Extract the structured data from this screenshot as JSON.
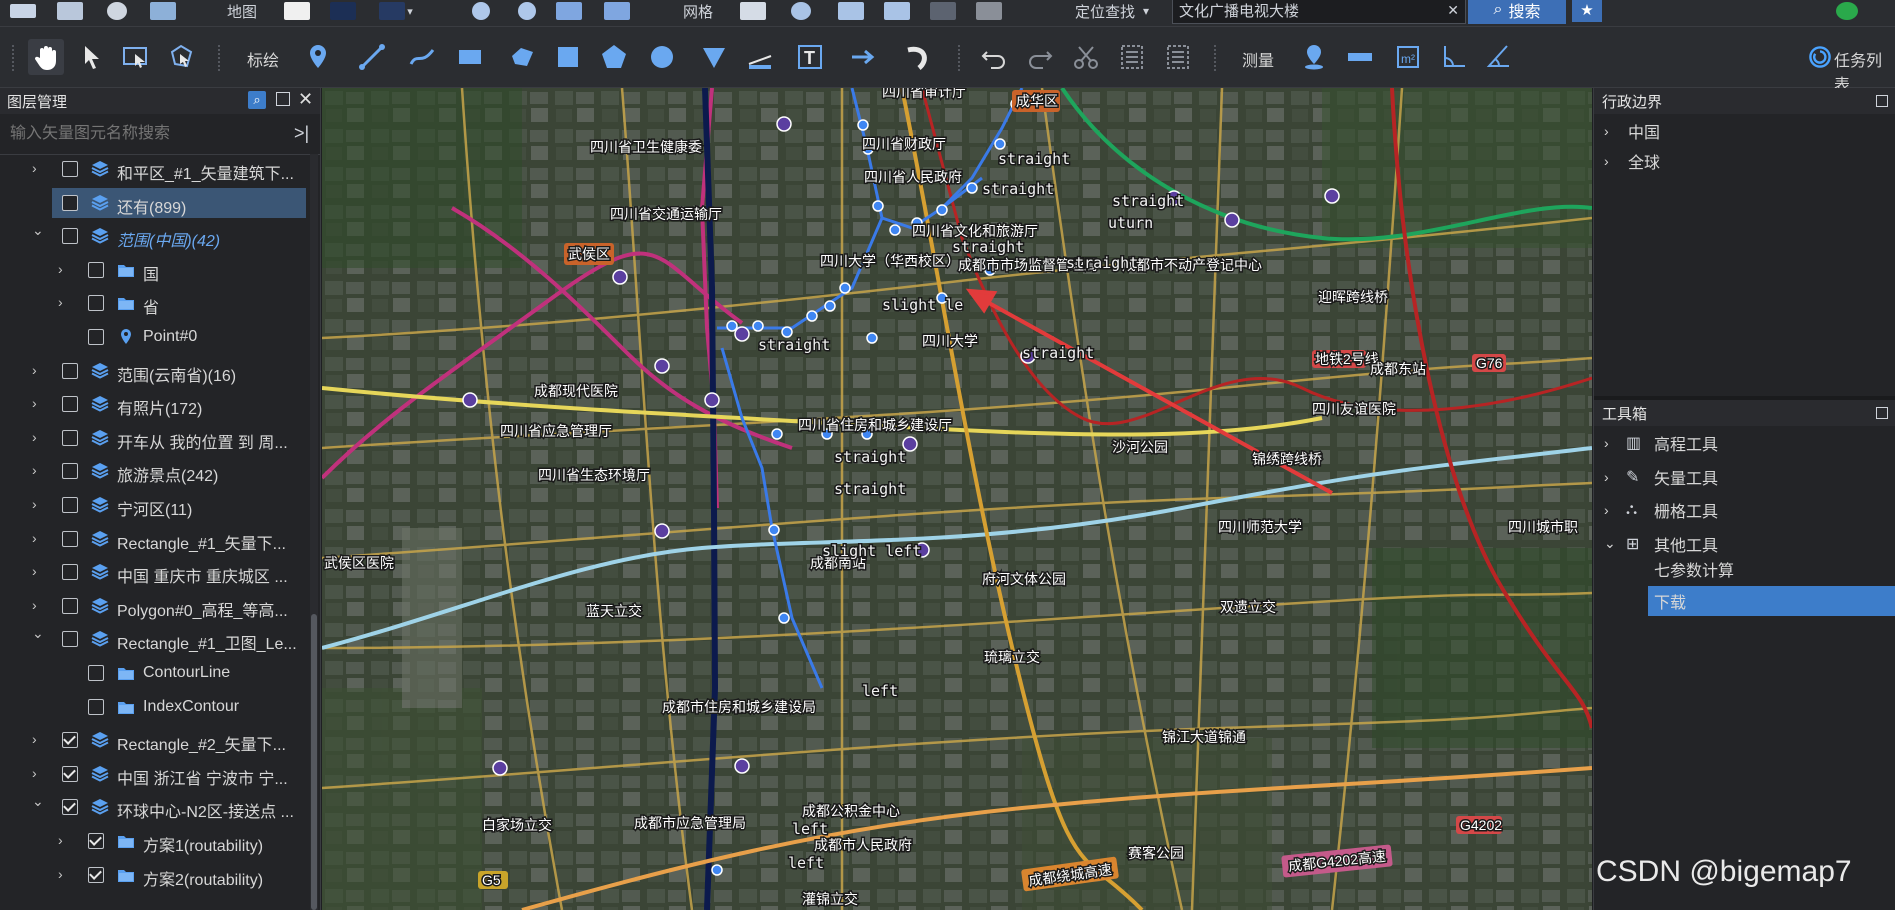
{
  "topbar": {
    "map_label": "地图",
    "grid_label": "网格",
    "locate_dropdown": "定位查找",
    "search_value": "文化广播电视大楼",
    "search_button": "搜索"
  },
  "toolbar": {
    "draw_label": "标绘",
    "measure_label": "测量",
    "task_list": "任务列表"
  },
  "layer_panel": {
    "title": "图层管理",
    "search_placeholder": "输入矢量图元名称搜索",
    "rows": [
      {
        "label": "和平区_#1_矢量建筑下...",
        "checked": false,
        "expander": "right",
        "icon": "layers-icon",
        "indent": 0
      },
      {
        "label": "还有(899)",
        "checked": false,
        "expander": "right",
        "icon": "layers-icon",
        "indent": 0,
        "selected": true
      },
      {
        "label": "范围(中国)(42)",
        "checked": false,
        "expander": "down",
        "icon": "layers-icon",
        "indent": 0,
        "italic": true
      },
      {
        "label": "国",
        "checked": false,
        "expander": "right",
        "icon": "folder-icon",
        "indent": 1
      },
      {
        "label": "省",
        "checked": false,
        "expander": "right",
        "icon": "folder-icon",
        "indent": 1
      },
      {
        "label": "Point#0",
        "checked": false,
        "expander": "none",
        "icon": "pin-icon",
        "indent": 1
      },
      {
        "label": "范围(云南省)(16)",
        "checked": false,
        "expander": "right",
        "icon": "layers-icon",
        "indent": 0
      },
      {
        "label": "有照片(172)",
        "checked": false,
        "expander": "right",
        "icon": "layers-icon",
        "indent": 0
      },
      {
        "label": "开车从 我的位置 到 周...",
        "checked": false,
        "expander": "right",
        "icon": "layers-icon",
        "indent": 0
      },
      {
        "label": "旅游景点(242)",
        "checked": false,
        "expander": "right",
        "icon": "layers-icon",
        "indent": 0
      },
      {
        "label": "宁河区(11)",
        "checked": false,
        "expander": "right",
        "icon": "layers-icon",
        "indent": 0
      },
      {
        "label": "Rectangle_#1_矢量下...",
        "checked": false,
        "expander": "right",
        "icon": "layers-icon",
        "indent": 0
      },
      {
        "label": "中国 重庆市 重庆城区 ...",
        "checked": false,
        "expander": "right",
        "icon": "layers-icon",
        "indent": 0
      },
      {
        "label": "Polygon#0_高程_等高...",
        "checked": false,
        "expander": "right",
        "icon": "layers-icon",
        "indent": 0
      },
      {
        "label": "Rectangle_#1_卫图_Le...",
        "checked": false,
        "expander": "down",
        "icon": "layers-icon",
        "indent": 0
      },
      {
        "label": "ContourLine",
        "checked": false,
        "expander": "none",
        "icon": "folder-icon",
        "indent": 1
      },
      {
        "label": "IndexContour",
        "checked": false,
        "expander": "none",
        "icon": "folder-icon",
        "indent": 1
      },
      {
        "label": "Rectangle_#2_矢量下...",
        "checked": true,
        "expander": "right",
        "icon": "layers-icon",
        "indent": 0
      },
      {
        "label": "中国 浙江省 宁波市 宁...",
        "checked": true,
        "expander": "right",
        "icon": "layers-icon",
        "indent": 0
      },
      {
        "label": "环球中心-N2区-接送点 ...",
        "checked": true,
        "expander": "down",
        "icon": "layers-icon",
        "indent": 0
      },
      {
        "label": "方案1(routability)",
        "checked": true,
        "expander": "right",
        "icon": "folder-icon",
        "indent": 1
      },
      {
        "label": "方案2(routability)",
        "checked": true,
        "expander": "right",
        "icon": "folder-icon",
        "indent": 1
      }
    ]
  },
  "admin_panel": {
    "title": "行政边界",
    "items": [
      "中国",
      "全球"
    ]
  },
  "toolbox_panel": {
    "title": "工具箱",
    "items": [
      {
        "label": "高程工具",
        "expander": "right"
      },
      {
        "label": "矢量工具",
        "expander": "right"
      },
      {
        "label": "栅格工具",
        "expander": "right"
      },
      {
        "label": "其他工具",
        "expander": "down"
      }
    ],
    "sub_items": [
      "七参数计算",
      "下载"
    ],
    "selected": "下载"
  },
  "map_labels": {
    "chenghua": "成华区",
    "wuhou": "武侯区",
    "shengshenji": "四川省审计厅",
    "weisheng": "四川省卫生健康委",
    "caizheng": "四川省财政厅",
    "renmin_gov": "四川省人民政府",
    "jiaotong": "四川省交通运输厅",
    "wenhua": "四川省文化和旅游厅",
    "sichuan_uni_hx": "四川大学（华西校区）",
    "market_reg": "成都市市场监督管理局",
    "real_estate": "成都市不动产登记中心",
    "sichuan_uni": "四川大学",
    "modern_hosp": "成都现代医院",
    "emergency": "四川省应急管理厅",
    "housing": "四川省住房和城乡建设厅",
    "eco_env": "四川省生态环境厅",
    "metro2": "地铁2号线",
    "chengdu_east": "成都东站",
    "youyi_hosp": "四川友谊医院",
    "shahe_park": "沙河公园",
    "jinxiu_bridge": "锦绣跨线桥",
    "normal_uni": "四川师范大学",
    "fuhe_park": "府河文体公园",
    "chengdu_south": "成都南站",
    "lantian": "蓝天立交",
    "liucheng": "琉璃立交",
    "cd_housing": "成都市住房和城乡建设局",
    "jinjiang_road": "锦江大道锦通",
    "cd_emergency": "成都市应急管理局",
    "cd_security": "成都公积金中心",
    "cd_people": "成都市人民政府",
    "baijia": "白家场立交",
    "shuangyi": "双遗立交",
    "ring_hwy": "成都绕城高速",
    "g4202_hwy": "成都G4202高速",
    "g4202": "G4202",
    "g76": "G76",
    "g5": "G5",
    "yinghui": "迎晖跨线桥",
    "wuhou_hosp": "武侯区医院",
    "hanhe": "四川城市职",
    "guanjin": "灌锦立交",
    "ying_park": "赛客公园",
    "route_straight": "straight",
    "route_uturn": "uturn",
    "route_slight_left": "slight left",
    "route_left": "left",
    "route_slight_le": "slight le"
  },
  "watermark": "CSDN @bigemap7"
}
